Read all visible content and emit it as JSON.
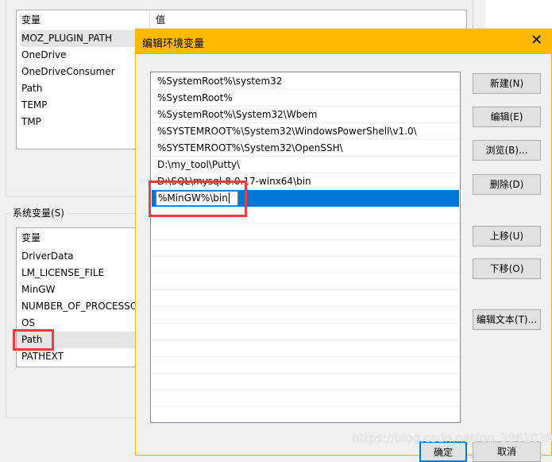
{
  "user_vars": {
    "header": {
      "name": "变量",
      "value": "值"
    },
    "items": [
      "MOZ_PLUGIN_PATH",
      "OneDrive",
      "OneDriveConsumer",
      "Path",
      "TEMP",
      "TMP"
    ]
  },
  "system_vars": {
    "label": "系统变量(S)",
    "header": "变量",
    "items": [
      "DriverData",
      "LM_LICENSE_FILE",
      "MinGW",
      "NUMBER_OF_PROCESSORS",
      "OS",
      "Path",
      "PATHEXT"
    ]
  },
  "dialog": {
    "title": "编辑环境变量",
    "paths": [
      "%SystemRoot%\\system32",
      "%SystemRoot%",
      "%SystemRoot%\\System32\\Wbem",
      "%SYSTEMROOT%\\System32\\WindowsPowerShell\\v1.0\\",
      "%SYSTEMROOT%\\System32\\OpenSSH\\",
      "D:\\my_tool\\Putty\\",
      "D:\\SQL\\mysql-8.0.17-winx64\\bin"
    ],
    "editing_value": "%MinGW%\\bin",
    "buttons": {
      "new": "新建(N)",
      "edit": "编辑(E)",
      "browse": "浏览(B)...",
      "delete": "删除(D)",
      "up": "上移(U)",
      "down": "下移(O)",
      "edit_text": "编辑文本(T)...",
      "ok": "确定",
      "cancel": "取消"
    }
  },
  "watermark": "https://blog.csdn.net/qq_39610398",
  "colors": {
    "title_bar": "#ffb900",
    "selection": "#0078d7",
    "highlight_box": "#f03c3c"
  }
}
